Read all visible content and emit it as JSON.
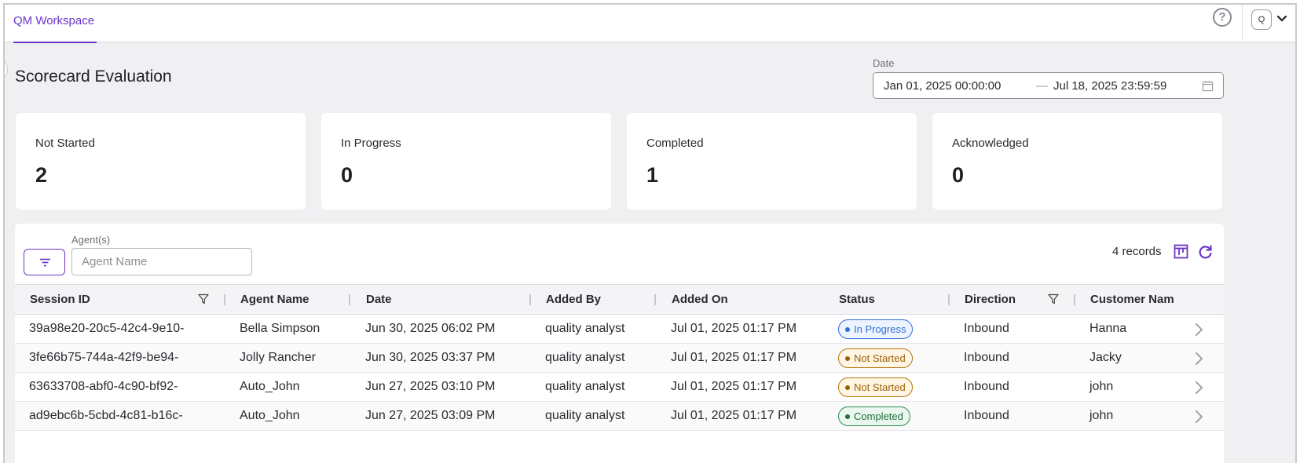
{
  "topbar": {
    "tab_label": "QM Workspace",
    "help_glyph": "?",
    "avatar_initial": "Q"
  },
  "page": {
    "title": "Scorecard Evaluation"
  },
  "date_filter": {
    "label": "Date",
    "from": "Jan 01, 2025 00:00:00",
    "separator": "—",
    "to": "Jul 18, 2025 23:59:59"
  },
  "stats": [
    {
      "label": "Not Started",
      "value": "2"
    },
    {
      "label": "In Progress",
      "value": "0"
    },
    {
      "label": "Completed",
      "value": "1"
    },
    {
      "label": "Acknowledged",
      "value": "0"
    }
  ],
  "toolbar": {
    "agent_label": "Agent(s)",
    "agent_placeholder": "Agent Name",
    "records": "4 records"
  },
  "table": {
    "columns": [
      "Session ID",
      "Agent Name",
      "Date",
      "Added By",
      "Added On",
      "Status",
      "Direction",
      "Customer Nam"
    ],
    "rows": [
      {
        "session_id": "39a98e20-20c5-42c4-9e10-",
        "agent": "Bella Simpson",
        "date": "Jun 30, 2025 06:02 PM",
        "added_by": "quality analyst",
        "added_on": "Jul 01, 2025 01:17 PM",
        "status": "In Progress",
        "direction": "Inbound",
        "customer": "Hanna"
      },
      {
        "session_id": "3fe66b75-744a-42f9-be94-",
        "agent": "Jolly Rancher",
        "date": "Jun 30, 2025 03:37 PM",
        "added_by": "quality analyst",
        "added_on": "Jul 01, 2025 01:17 PM",
        "status": "Not Started",
        "direction": "Inbound",
        "customer": "Jacky"
      },
      {
        "session_id": "63633708-abf0-4c90-bf92-",
        "agent": "Auto_John",
        "date": "Jun 27, 2025 03:10 PM",
        "added_by": "quality analyst",
        "added_on": "Jul 01, 2025 01:17 PM",
        "status": "Not Started",
        "direction": "Inbound",
        "customer": "john"
      },
      {
        "session_id": "ad9ebc6b-5cbd-4c81-b16c-",
        "agent": "Auto_John",
        "date": "Jun 27, 2025 03:09 PM",
        "added_by": "quality analyst",
        "added_on": "Jul 01, 2025 01:17 PM",
        "status": "Completed",
        "direction": "Inbound",
        "customer": "john"
      }
    ]
  },
  "icons": {
    "help": "help-circle-icon",
    "chevron": "chevron-down-icon",
    "calendar": "calendar-icon",
    "filter": "filter-lines-icon",
    "columns": "columns-icon",
    "refresh": "refresh-icon",
    "column_filter": "funnel-icon",
    "row_open": "chevron-right-icon"
  },
  "colors": {
    "accent": "#6b35c9",
    "in_progress": "#2f6fd6",
    "not_started": "#b8740b",
    "completed": "#2e8a4f"
  }
}
